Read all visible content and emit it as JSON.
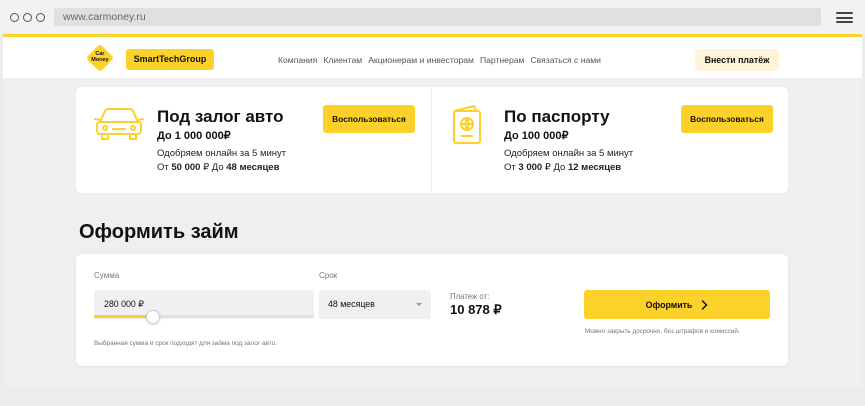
{
  "browser": {
    "url": "www.carmoney.ru"
  },
  "header": {
    "logo_text_top": "Car",
    "logo_text_bottom": "Money",
    "brand_button": "SmartTechGroup",
    "nav": [
      "Компания",
      "Клиентам",
      "Акционерам и инвесторам",
      "Партнерам",
      "Связаться с нами"
    ],
    "pay_button": "Внести платёж"
  },
  "products": [
    {
      "icon": "car-icon",
      "title": "Под залог авто",
      "amount": "До 1 000 000₽",
      "line1": "Одобряем онлайн за 5 минут",
      "from_prefix": "От ",
      "from_value": "50 000",
      "from_mid": " ₽ До ",
      "term_value": "48 месяцев",
      "button": "Воспользоваться"
    },
    {
      "icon": "passport-icon",
      "title": "По паспорту",
      "amount": "До 100 000₽",
      "line1": "Одобряем онлайн за 5 минут",
      "from_prefix": "От ",
      "from_value": "3 000",
      "from_mid": " ₽ До ",
      "term_value": "12 месяцев",
      "button": "Воспользоваться"
    }
  ],
  "form": {
    "heading": "Оформить займ",
    "sum_label": "Сумма",
    "sum_value": "280 000 ₽",
    "slider_fraction": 0.27,
    "term_label": "Срок",
    "term_value": "48 месяцев",
    "payment_label": "Платеж от:",
    "payment_value": "10 878 ₽",
    "submit": "Оформить",
    "hint_left": "Выбранная сумма и срок подходят для займа под залог авто.",
    "hint_right": "Можно закрыть досрочно, без штрафов и комиссий."
  },
  "colors": {
    "accent": "#fcd12a",
    "accent_soft": "#fff4d8"
  }
}
